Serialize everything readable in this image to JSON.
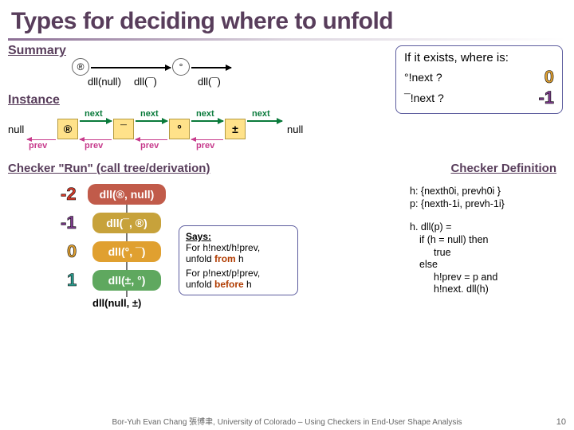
{
  "title": "Types for deciding where to unfold",
  "labels": {
    "summary": "Summary",
    "instance": "Instance",
    "run": "Checker \"Run\" (call tree/derivation)",
    "definition": "Checker Definition"
  },
  "summary": {
    "nodeR": "®",
    "nodeO": "°",
    "seg1": "dll(null)",
    "seg2": "dll(¯)",
    "seg3": "dll(¯)"
  },
  "instance": {
    "leftNull": "null",
    "rightNull": "null",
    "prev": "prev",
    "next": "next",
    "b1": "®",
    "b2": "¯",
    "b3": "°",
    "b4": "±"
  },
  "callout": {
    "header": "If it exists, where is:",
    "q1": "°!next ?",
    "a1": "0",
    "q2": "¯!next ?",
    "a2": "-1"
  },
  "run": {
    "n2": "-2",
    "n1": "-1",
    "n0": "0",
    "np1": "1",
    "r1": "dll(®, null)",
    "r2": "dll(¯, ®)",
    "r3": "dll(°, ¯)",
    "r4": "dll(±, °)",
    "r5": "dll(null, ±)"
  },
  "says": {
    "title": "Says:",
    "l1a": "For h!next/h!prev,",
    "l1b": "unfold ",
    "l1c": "from",
    "l1d": " h",
    "l2a": "For p!next/p!prev,",
    "l2b": "unfold ",
    "l2c": "before",
    "l2d": " h"
  },
  "def": {
    "hline": "h: {nexth0i, prevh0i }",
    "pline": "p: {nexth-1i, prevh-1i}",
    "l1": "h. dll(p) =",
    "l2": "if (h = null) then",
    "l3": "true",
    "l4": "else",
    "l5": "h!prev = p and",
    "l6": "h!next. dll(h)"
  },
  "footer": "Bor-Yuh Evan Chang 張博聿, University of Colorado – Using Checkers in End-User Shape Analysis",
  "page": "10"
}
